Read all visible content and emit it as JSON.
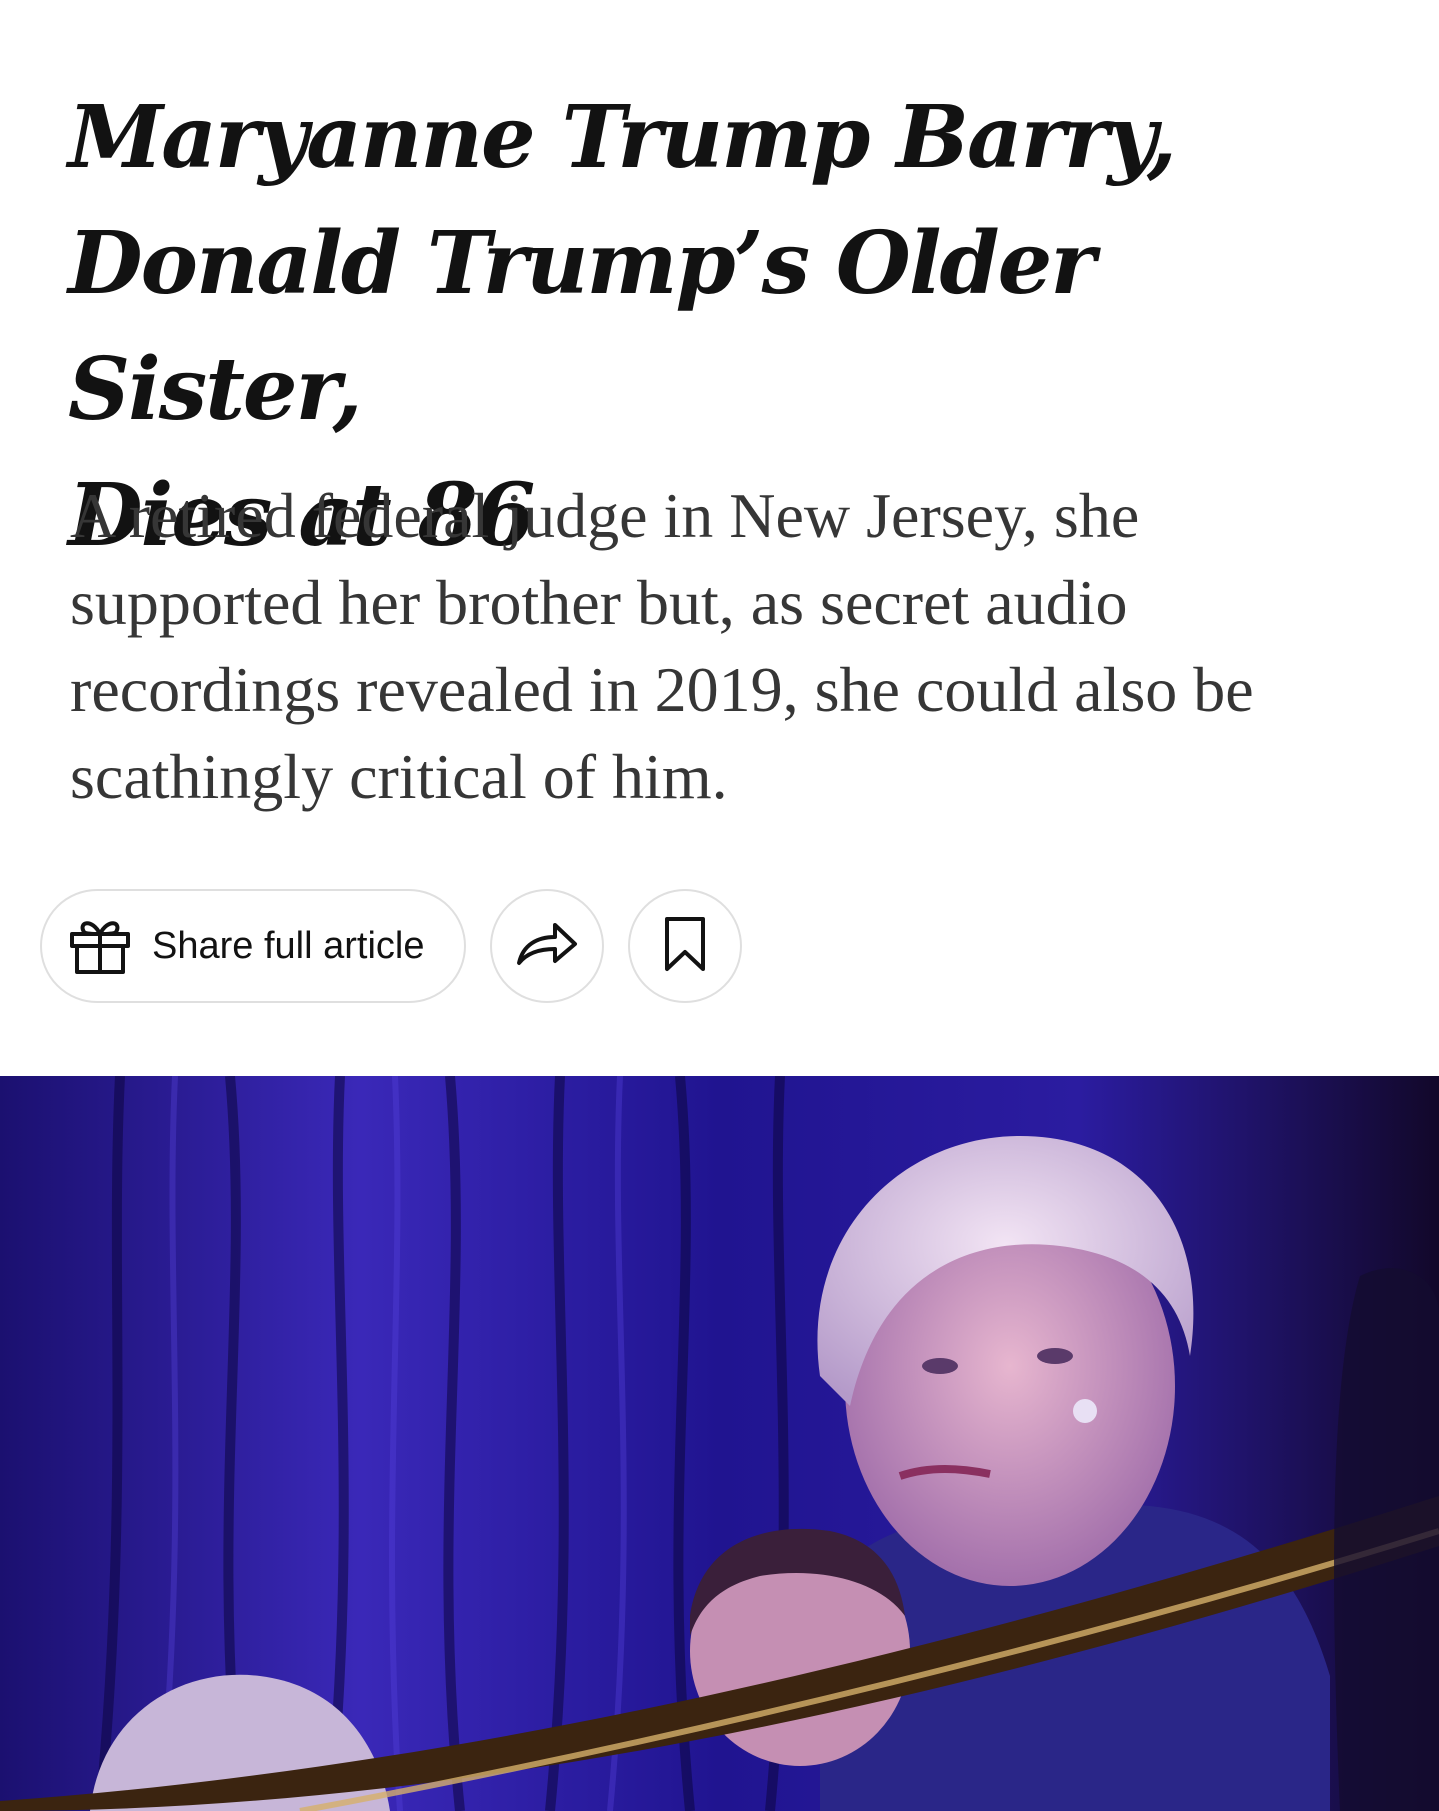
{
  "headline": {
    "line1": "Maryanne Trump Barry,",
    "line2": "Donald Trump’s Older Sister,",
    "line3": "Dies at 86"
  },
  "summary": "A retired federal judge in New Jersey, she supported her brother but, as secret audio recordings revealed in 2019, she could also be scathingly critical of him.",
  "actions": {
    "share_full_label": "Share full article",
    "gift_icon": "gift-icon",
    "share_icon": "share-arrow-icon",
    "save_icon": "bookmark-icon"
  },
  "image": {
    "subject": "lead-photo"
  },
  "colors": {
    "text": "#121212",
    "summary_text": "#363636",
    "button_border": "#dfdfdf",
    "photo_curtain": "#2a1a8c"
  }
}
